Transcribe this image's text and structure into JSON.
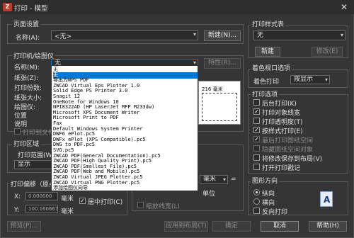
{
  "window": {
    "title": "打印 - 模型",
    "app_icon": "Z",
    "close_symbol": "✕"
  },
  "page_setup": {
    "group_label": "页面设置",
    "name_label": "名称(A):",
    "name_value": "<无>",
    "new_button": "新建(N)..."
  },
  "printer": {
    "group_label": "打印机/绘图仪",
    "name_label": "名称(M):",
    "name_value": "无",
    "properties_button": "特性(R)...",
    "paper_label": "纸张(Z):",
    "print_count_label": "打印份数:",
    "paper_size_label": "纸张大小:",
    "plotter_label": "绘图仪:",
    "location_label": "位置",
    "description_label": "说明",
    "print_to_file_label": "打印到文件(F)"
  },
  "printer_options": [
    {
      "label": "无",
      "selected": false
    },
    {
      "label": "无",
      "selected": true
    },
    {
      "label": "导出为WPS PDF",
      "selected": false
    },
    {
      "label": "ZWCAD Virtual Eps Plotter 1.0",
      "selected": false
    },
    {
      "label": "Solid Edge PS Printer 3.0",
      "selected": false
    },
    {
      "label": "Snagit 12",
      "selected": false
    },
    {
      "label": "OneNote for Windows 10",
      "selected": false
    },
    {
      "label": "NPI8322AD (HP LaserJet MFP M233dw)",
      "selected": false
    },
    {
      "label": "Microsoft XPS Document Writer",
      "selected": false
    },
    {
      "label": "Microsoft Print to PDF",
      "selected": false
    },
    {
      "label": "Fax",
      "selected": false
    },
    {
      "label": "Default Windows System Printer",
      "selected": false
    },
    {
      "label": "DWF6 ePlot.pc5",
      "selected": false
    },
    {
      "label": "DWFx ePlot (XPS Compatible).pc5",
      "selected": false
    },
    {
      "label": "DWG to PDF.pc5",
      "selected": false
    },
    {
      "label": "SVG.pc5",
      "selected": false
    },
    {
      "label": "ZWCAD PDF(General Documentation).pc5",
      "selected": false
    },
    {
      "label": "ZWCAD PDF(High Quality Print).pc5",
      "selected": false
    },
    {
      "label": "ZWCAD PDF(Smallest File).pc5",
      "selected": false
    },
    {
      "label": "ZWCAD PDF(Web and Mobile).pc5",
      "selected": false
    },
    {
      "label": "ZWCAD Virtual JPEG Plotter.pc5",
      "selected": false
    },
    {
      "label": "ZWCAD Virtual PNG Plotter.pc5",
      "selected": false
    },
    {
      "label": "添加绘图仪向导",
      "selected": false
    }
  ],
  "preview": {
    "dimension_label": "216 毫米"
  },
  "print_area": {
    "group_label": "打印区域",
    "range_label": "打印范围(W):",
    "range_value": "显示"
  },
  "print_offset": {
    "group_label": "打印偏移（原点设置在可打印区域）",
    "x_label": "X:",
    "x_value": "0.000000",
    "y_label": "Y:",
    "y_value": "100.160667",
    "unit": "毫米",
    "center_label": "居中打印(C)"
  },
  "scale": {
    "unit_value": "毫米",
    "equals": "=",
    "unit_label": "单位",
    "lineweight_label": "缩放线宽(L)"
  },
  "style_table": {
    "group_label": "打印样式表",
    "value": "无",
    "new_button": "新建",
    "edit_button": "修改(E)"
  },
  "shaded_viewport": {
    "group_label": "着色视口选项",
    "shade_label": "着色打印",
    "shade_value": "按显示"
  },
  "options": {
    "group_label": "打印选项",
    "items": [
      {
        "label": "后台打印(K)",
        "checked": false,
        "enabled": true
      },
      {
        "label": "打印对象线宽",
        "checked": true,
        "enabled": true
      },
      {
        "label": "打印透明度(T)",
        "checked": false,
        "enabled": true
      },
      {
        "label": "按样式打印(E)",
        "checked": true,
        "enabled": true
      },
      {
        "label": "最后打印图纸空间",
        "checked": true,
        "enabled": false
      },
      {
        "label": "隐藏图纸空间对象",
        "checked": false,
        "enabled": false
      },
      {
        "label": "将修改保存到布局(V)",
        "checked": false,
        "enabled": true
      },
      {
        "label": "打开打印戳记",
        "checked": false,
        "enabled": true
      }
    ]
  },
  "orientation": {
    "group_label": "图形方向",
    "portrait": "纵向",
    "landscape": "横向",
    "reverse": "反向打印",
    "icon_letter": "A"
  },
  "bottom": {
    "preview_button": "预览(P)...",
    "apply_button": "应用到布局(T)",
    "ok_button": "确定",
    "cancel_button": "取消",
    "help_button": "帮助(H)"
  }
}
